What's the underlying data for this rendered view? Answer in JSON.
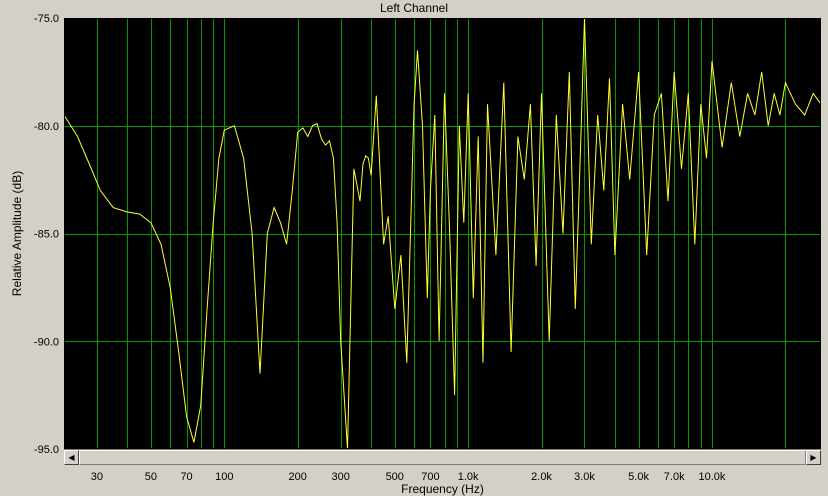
{
  "window": {
    "title": "Left Channel"
  },
  "colors": {
    "background": "#000000",
    "grid": "#009a00",
    "trace": "#ffff33",
    "panel": "#d4d0c8"
  },
  "scrollbar": {
    "left_icon": "left-arrow-icon",
    "right_icon": "right-arrow-icon"
  },
  "chart_data": {
    "type": "line",
    "title": "Left Channel",
    "xlabel": "Frequency (Hz)",
    "ylabel": "Relative Amplitude (dB)",
    "x_scale": "log",
    "xlim": [
      22,
      28000
    ],
    "ylim": [
      -95,
      -75
    ],
    "grid": true,
    "x_ticks": [
      {
        "value": 30,
        "label": "30"
      },
      {
        "value": 50,
        "label": "50"
      },
      {
        "value": 70,
        "label": "70"
      },
      {
        "value": 100,
        "label": "100"
      },
      {
        "value": 200,
        "label": "200"
      },
      {
        "value": 300,
        "label": "300"
      },
      {
        "value": 500,
        "label": "500"
      },
      {
        "value": 700,
        "label": "700"
      },
      {
        "value": 1000,
        "label": "1.0k"
      },
      {
        "value": 2000,
        "label": "2.0k"
      },
      {
        "value": 3000,
        "label": "3.0k"
      },
      {
        "value": 5000,
        "label": "5.0k"
      },
      {
        "value": 7000,
        "label": "7.0k"
      },
      {
        "value": 10000,
        "label": "10.0k"
      }
    ],
    "y_ticks": [
      {
        "value": -75,
        "label": "-75.0"
      },
      {
        "value": -80,
        "label": "-80.0"
      },
      {
        "value": -85,
        "label": "-85.0"
      },
      {
        "value": -90,
        "label": "-90.0"
      },
      {
        "value": -95,
        "label": "-95.0"
      }
    ],
    "series": [
      {
        "color": "#ffff33",
        "x": [
          22,
          25,
          28,
          31,
          35,
          40,
          45,
          50,
          55,
          60,
          65,
          70,
          75,
          80,
          85,
          90,
          95,
          100,
          110,
          120,
          130,
          140,
          150,
          160,
          170,
          180,
          190,
          200,
          210,
          220,
          230,
          240,
          250,
          260,
          270,
          280,
          290,
          300,
          320,
          340,
          360,
          370,
          380,
          390,
          400,
          420,
          450,
          470,
          500,
          530,
          560,
          600,
          620,
          650,
          680,
          700,
          730,
          760,
          800,
          840,
          880,
          920,
          960,
          1000,
          1050,
          1100,
          1150,
          1200,
          1300,
          1400,
          1500,
          1600,
          1700,
          1800,
          1900,
          2000,
          2150,
          2300,
          2450,
          2600,
          2750,
          2900,
          3000,
          3200,
          3400,
          3600,
          3800,
          4000,
          4300,
          4600,
          5000,
          5400,
          5800,
          6200,
          6600,
          7000,
          7500,
          8000,
          8500,
          9000,
          9500,
          10000,
          11000,
          12000,
          13000,
          14000,
          15000,
          16000,
          17000,
          18000,
          19000,
          20000,
          22000,
          24000,
          26000,
          28000
        ],
        "y": [
          -79.5,
          -80.5,
          -81.8,
          -83.0,
          -83.8,
          -84.0,
          -84.1,
          -84.5,
          -85.5,
          -87.5,
          -90.5,
          -93.5,
          -94.7,
          -93.0,
          -88.5,
          -84.5,
          -81.5,
          -80.2,
          -80.0,
          -81.5,
          -85.0,
          -91.5,
          -85.0,
          -83.8,
          -84.5,
          -85.5,
          -83.0,
          -80.3,
          -80.1,
          -80.5,
          -80.0,
          -79.9,
          -80.6,
          -80.9,
          -80.7,
          -81.5,
          -84.5,
          -90.0,
          -95.0,
          -82.0,
          -83.5,
          -81.8,
          -81.4,
          -81.5,
          -82.3,
          -78.6,
          -85.5,
          -84.2,
          -88.5,
          -86.0,
          -91.0,
          -79.0,
          -76.5,
          -80.0,
          -88.0,
          -83.0,
          -79.5,
          -90.0,
          -78.5,
          -85.0,
          -92.5,
          -80.0,
          -84.5,
          -78.5,
          -88.0,
          -80.5,
          -91.0,
          -79.0,
          -86.0,
          -78.0,
          -90.5,
          -80.5,
          -82.5,
          -79.0,
          -86.5,
          -78.5,
          -90.0,
          -79.5,
          -85.0,
          -77.5,
          -88.5,
          -80.5,
          -75.0,
          -85.5,
          -79.5,
          -83.0,
          -77.8,
          -86.0,
          -79.0,
          -82.5,
          -77.5,
          -86.0,
          -79.5,
          -78.5,
          -83.5,
          -77.5,
          -82.0,
          -78.5,
          -85.5,
          -79.0,
          -81.5,
          -77.0,
          -81.0,
          -78.0,
          -80.5,
          -78.5,
          -79.5,
          -77.5,
          -80.0,
          -78.5,
          -79.5,
          -78.0,
          -79.0,
          -79.5,
          -78.5,
          -79.0
        ]
      }
    ]
  }
}
